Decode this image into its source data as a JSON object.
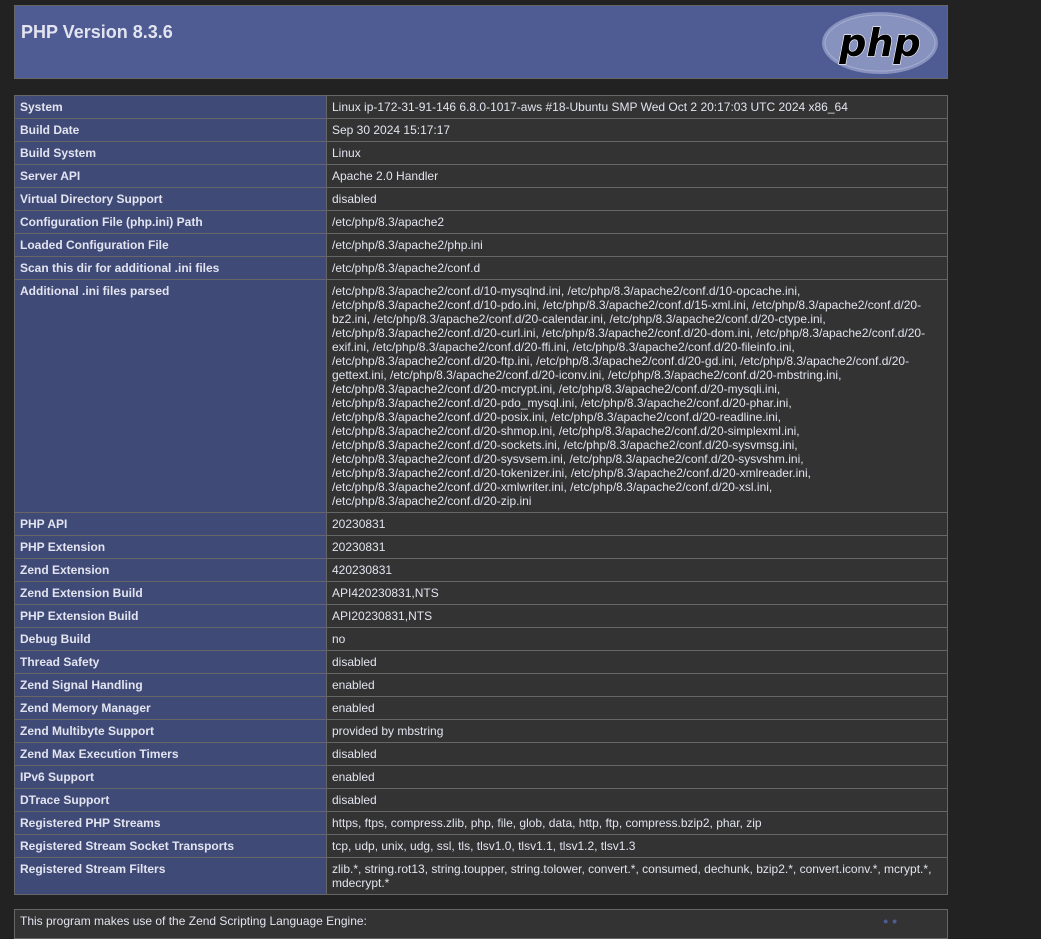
{
  "header": {
    "title": "PHP Version 8.3.6",
    "logo_text": "php"
  },
  "colors": {
    "header_bg": "#4f5b93",
    "label_bg": "#404a77",
    "value_bg": "#333333",
    "page_bg": "#222222",
    "text": "#e2e4ef"
  },
  "rows": [
    {
      "label": "System",
      "value": "Linux ip-172-31-91-146 6.8.0-1017-aws #18-Ubuntu SMP Wed Oct 2 20:17:03 UTC 2024 x86_64"
    },
    {
      "label": "Build Date",
      "value": "Sep 30 2024 15:17:17"
    },
    {
      "label": "Build System",
      "value": "Linux"
    },
    {
      "label": "Server API",
      "value": "Apache 2.0 Handler"
    },
    {
      "label": "Virtual Directory Support",
      "value": "disabled"
    },
    {
      "label": "Configuration File (php.ini) Path",
      "value": "/etc/php/8.3/apache2"
    },
    {
      "label": "Loaded Configuration File",
      "value": "/etc/php/8.3/apache2/php.ini"
    },
    {
      "label": "Scan this dir for additional .ini files",
      "value": "/etc/php/8.3/apache2/conf.d"
    },
    {
      "label": "Additional .ini files parsed",
      "value": "/etc/php/8.3/apache2/conf.d/10-mysqlnd.ini, /etc/php/8.3/apache2/conf.d/10-opcache.ini, /etc/php/8.3/apache2/conf.d/10-pdo.ini, /etc/php/8.3/apache2/conf.d/15-xml.ini, /etc/php/8.3/apache2/conf.d/20-bz2.ini, /etc/php/8.3/apache2/conf.d/20-calendar.ini, /etc/php/8.3/apache2/conf.d/20-ctype.ini, /etc/php/8.3/apache2/conf.d/20-curl.ini, /etc/php/8.3/apache2/conf.d/20-dom.ini, /etc/php/8.3/apache2/conf.d/20-exif.ini, /etc/php/8.3/apache2/conf.d/20-ffi.ini, /etc/php/8.3/apache2/conf.d/20-fileinfo.ini, /etc/php/8.3/apache2/conf.d/20-ftp.ini, /etc/php/8.3/apache2/conf.d/20-gd.ini, /etc/php/8.3/apache2/conf.d/20-gettext.ini, /etc/php/8.3/apache2/conf.d/20-iconv.ini, /etc/php/8.3/apache2/conf.d/20-mbstring.ini, /etc/php/8.3/apache2/conf.d/20-mcrypt.ini, /etc/php/8.3/apache2/conf.d/20-mysqli.ini, /etc/php/8.3/apache2/conf.d/20-pdo_mysql.ini, /etc/php/8.3/apache2/conf.d/20-phar.ini, /etc/php/8.3/apache2/conf.d/20-posix.ini, /etc/php/8.3/apache2/conf.d/20-readline.ini, /etc/php/8.3/apache2/conf.d/20-shmop.ini, /etc/php/8.3/apache2/conf.d/20-simplexml.ini, /etc/php/8.3/apache2/conf.d/20-sockets.ini, /etc/php/8.3/apache2/conf.d/20-sysvmsg.ini, /etc/php/8.3/apache2/conf.d/20-sysvsem.ini, /etc/php/8.3/apache2/conf.d/20-sysvshm.ini, /etc/php/8.3/apache2/conf.d/20-tokenizer.ini, /etc/php/8.3/apache2/conf.d/20-xmlreader.ini, /etc/php/8.3/apache2/conf.d/20-xmlwriter.ini, /etc/php/8.3/apache2/conf.d/20-xsl.ini, /etc/php/8.3/apache2/conf.d/20-zip.ini"
    },
    {
      "label": "PHP API",
      "value": "20230831"
    },
    {
      "label": "PHP Extension",
      "value": "20230831"
    },
    {
      "label": "Zend Extension",
      "value": "420230831"
    },
    {
      "label": "Zend Extension Build",
      "value": "API420230831,NTS"
    },
    {
      "label": "PHP Extension Build",
      "value": "API20230831,NTS"
    },
    {
      "label": "Debug Build",
      "value": "no"
    },
    {
      "label": "Thread Safety",
      "value": "disabled"
    },
    {
      "label": "Zend Signal Handling",
      "value": "enabled"
    },
    {
      "label": "Zend Memory Manager",
      "value": "enabled"
    },
    {
      "label": "Zend Multibyte Support",
      "value": "provided by mbstring"
    },
    {
      "label": "Zend Max Execution Timers",
      "value": "disabled"
    },
    {
      "label": "IPv6 Support",
      "value": "enabled"
    },
    {
      "label": "DTrace Support",
      "value": "disabled"
    },
    {
      "label": "Registered PHP Streams",
      "value": "https, ftps, compress.zlib, php, file, glob, data, http, ftp, compress.bzip2, phar, zip"
    },
    {
      "label": "Registered Stream Socket Transports",
      "value": "tcp, udp, unix, udg, ssl, tls, tlsv1.0, tlsv1.1, tlsv1.2, tlsv1.3"
    },
    {
      "label": "Registered Stream Filters",
      "value": "zlib.*, string.rot13, string.toupper, string.tolower, convert.*, consumed, dechunk, bzip2.*, convert.iconv.*, mcrypt.*, mdecrypt.*"
    }
  ],
  "footer": {
    "text": "This program makes use of the Zend Scripting Language Engine:"
  }
}
